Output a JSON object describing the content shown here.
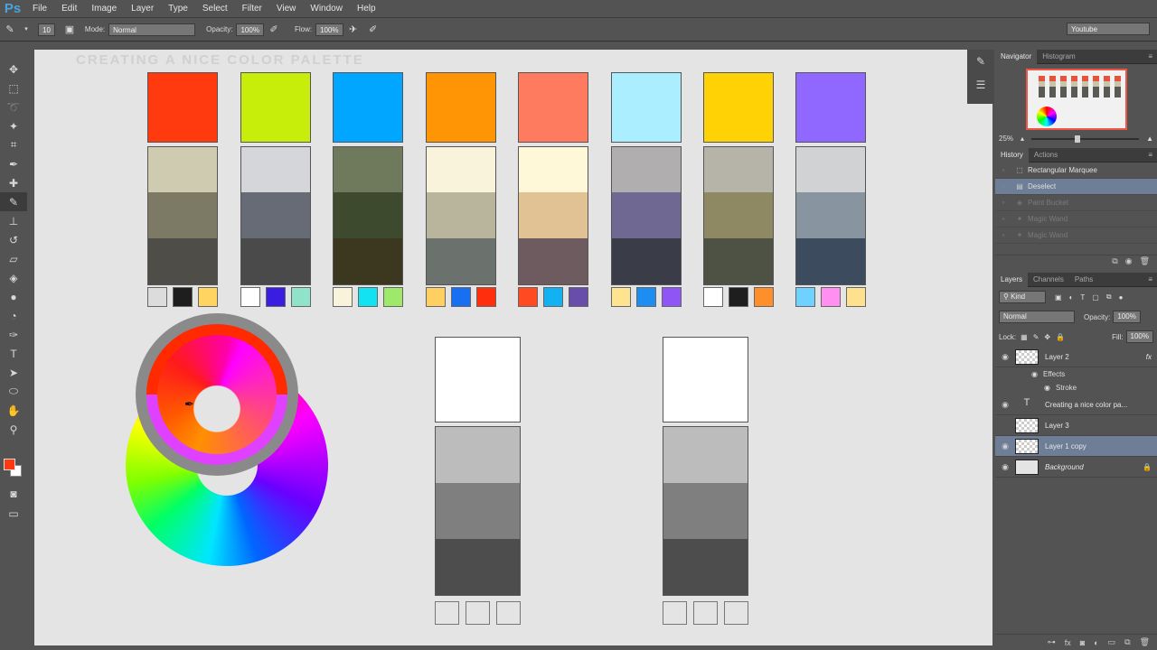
{
  "app": {
    "logo": "Ps"
  },
  "menu": [
    "File",
    "Edit",
    "Image",
    "Layer",
    "Type",
    "Select",
    "Filter",
    "View",
    "Window",
    "Help"
  ],
  "options": {
    "brush_size": "10",
    "mode_label": "Mode:",
    "mode_value": "Normal",
    "opacity_label": "Opacity:",
    "opacity_value": "100%",
    "flow_label": "Flow:",
    "flow_value": "100%",
    "workspace": "Youtube"
  },
  "canvas": {
    "title": "CREATING A NICE COLOR PALETTE",
    "palettes": [
      {
        "top": "#ff3a0e",
        "shades": [
          "#cfcbb0",
          "#7c7a64",
          "#4f4d47"
        ],
        "minis": [
          "#dcdcdc",
          "#1e1e1e",
          "#ffd460"
        ]
      },
      {
        "top": "#c7ee0a",
        "shades": [
          "#d4d6d9",
          "#666b75",
          "#4a4a4a"
        ],
        "minis": [
          "#ffffff",
          "#3a1de0",
          "#8ee3c8"
        ]
      },
      {
        "top": "#00a6ff",
        "shades": [
          "#6f7a5c",
          "#3e4a2d",
          "#3c3820"
        ],
        "minis": [
          "#faf3dc",
          "#12e2f2",
          "#9ee86a"
        ]
      },
      {
        "top": "#ff9405",
        "shades": [
          "#faf3dc",
          "#b9b59c",
          "#6b716c"
        ],
        "minis": [
          "#ffcf62",
          "#1770f2",
          "#ff2e0d"
        ]
      },
      {
        "top": "#ff7b5f",
        "shades": [
          "#fff8d8",
          "#e1c294",
          "#6d5b60"
        ],
        "minis": [
          "#ff4a22",
          "#12b2f2",
          "#684eaa"
        ]
      },
      {
        "top": "#aaeeff",
        "shades": [
          "#b1aeb0",
          "#6e6892",
          "#3a3c48"
        ],
        "minis": [
          "#ffe38f",
          "#1d8df2",
          "#9056f5"
        ]
      },
      {
        "top": "#ffd205",
        "shades": [
          "#b6b4a9",
          "#8f8963",
          "#4d5244"
        ],
        "minis": [
          "#ffffff",
          "#1e1e1e",
          "#ff8f2b"
        ]
      },
      {
        "top": "#9067ff",
        "shades": [
          "#d1d2d3",
          "#8894a0",
          "#3c4b5e"
        ],
        "minis": [
          "#6fd1ff",
          "#ff8ff0",
          "#ffe08f"
        ]
      }
    ],
    "gray_palettes": [
      {
        "shades": [
          "#bcbcbc",
          "#7f7f7f",
          "#4d4d4d"
        ]
      },
      {
        "shades": [
          "#bcbcbc",
          "#7f7f7f",
          "#4d4d4d"
        ]
      }
    ]
  },
  "navigator": {
    "tabs": [
      "Navigator",
      "Histogram"
    ],
    "zoom": "25%"
  },
  "history": {
    "tabs": [
      "History",
      "Actions"
    ],
    "items": [
      {
        "label": "Rectangular Marquee",
        "state": "normal"
      },
      {
        "label": "Deselect",
        "state": "selected"
      },
      {
        "label": "Paint Bucket",
        "state": "dim"
      },
      {
        "label": "Magic Wand",
        "state": "dim"
      },
      {
        "label": "Magic Wand",
        "state": "dim"
      }
    ]
  },
  "layers": {
    "tabs": [
      "Layers",
      "Channels",
      "Paths"
    ],
    "kind": "Kind",
    "blend": "Normal",
    "opacity_label": "Opacity:",
    "opacity_value": "100%",
    "lock_label": "Lock:",
    "fill_label": "Fill:",
    "fill_value": "100%",
    "items": {
      "layer2": "Layer 2",
      "effects": "Effects",
      "stroke": "Stroke",
      "text": "Creating a nice color pa...",
      "layer3": "Layer 3",
      "layer1copy": "Layer 1 copy",
      "background": "Background"
    }
  }
}
